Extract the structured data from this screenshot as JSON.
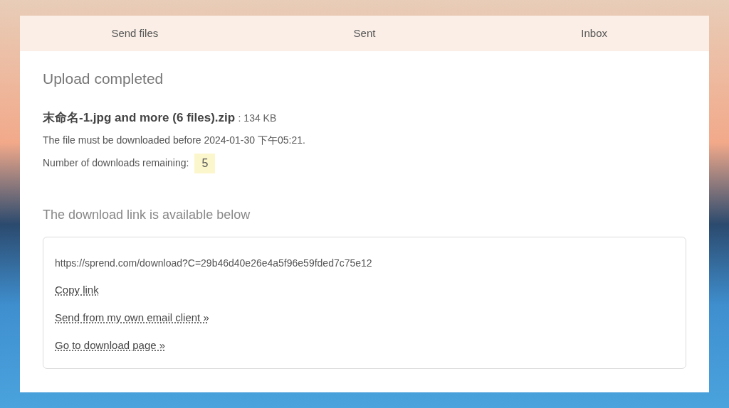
{
  "tabs": [
    {
      "label": "Send files"
    },
    {
      "label": "Sent"
    },
    {
      "label": "Inbox"
    }
  ],
  "upload": {
    "title": "Upload completed",
    "file_name": "末命名-1.jpg and more (6 files).zip",
    "file_size": ": 134 KB",
    "deadline": "The file must be downloaded before 2024-01-30  下午05:21.",
    "downloads_label": "Number of downloads remaining:",
    "downloads_remaining": "5"
  },
  "download": {
    "heading": "The download link is available below",
    "url": "https://sprend.com/download?C=29b46d40e26e4a5f96e59fded7c75e12",
    "links": [
      "Copy link",
      "Send from my own email client »",
      "Go to download page »"
    ]
  }
}
